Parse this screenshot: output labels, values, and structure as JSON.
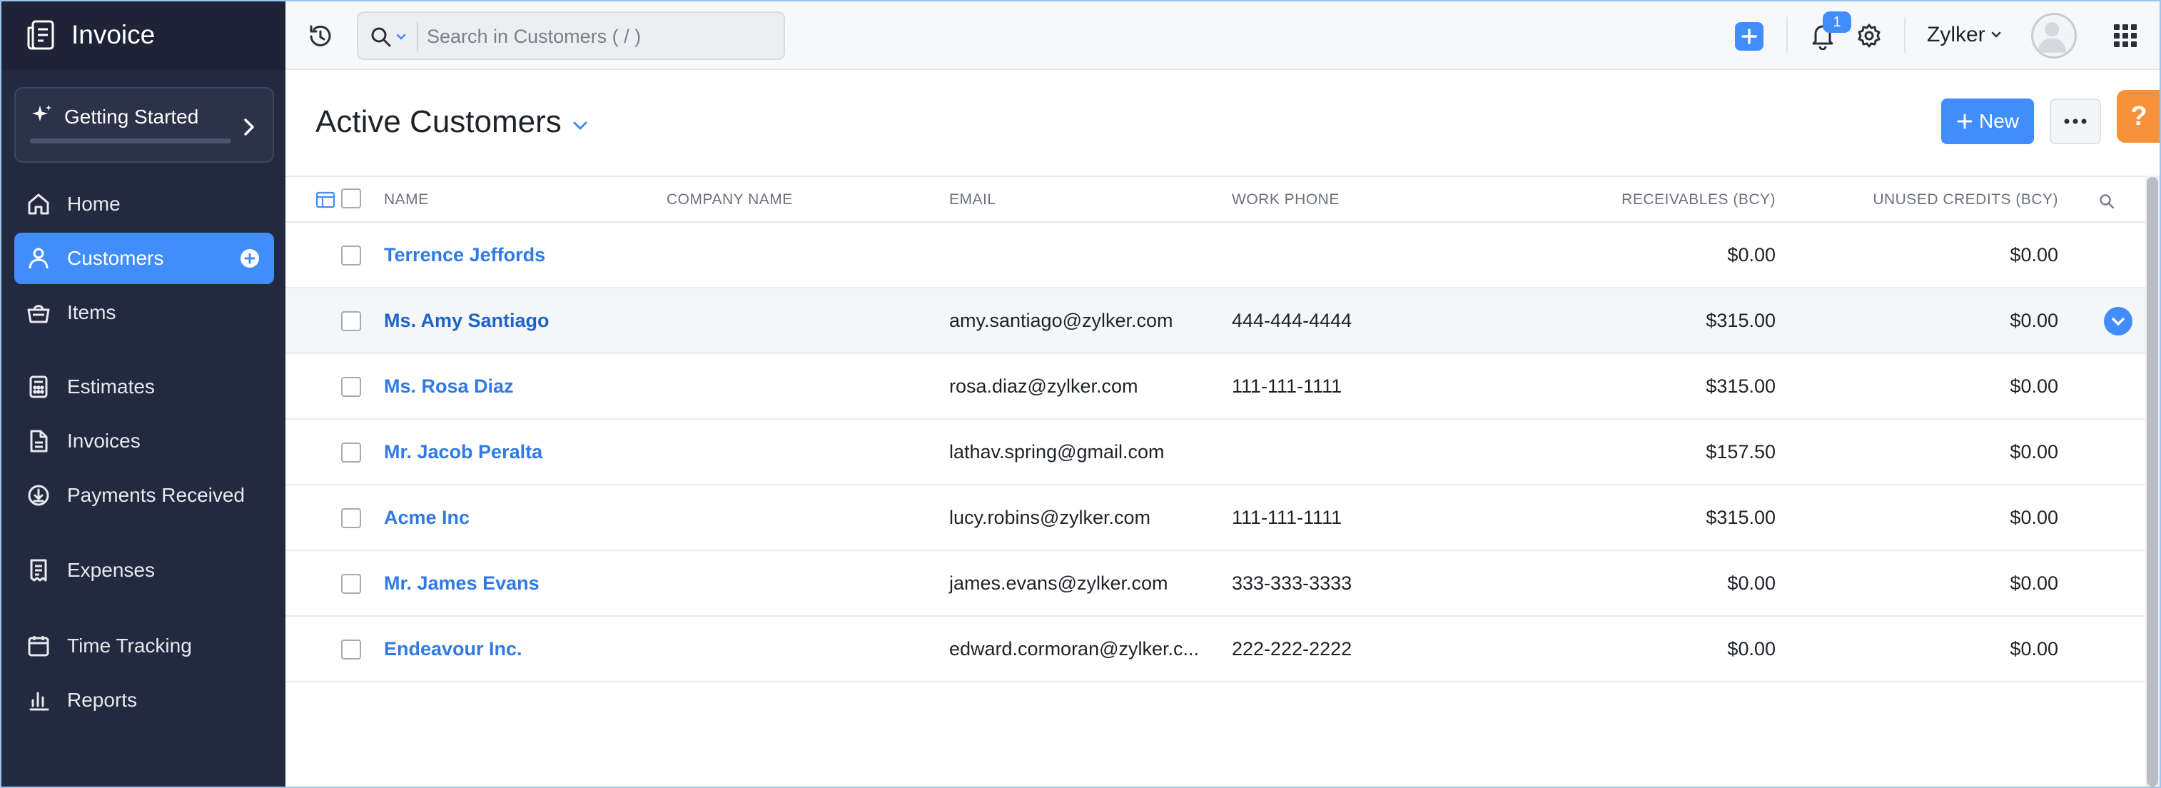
{
  "app": {
    "name": "Invoice"
  },
  "sidebar": {
    "getting_started": "Getting Started",
    "items": [
      {
        "label": "Home",
        "icon": "home-icon"
      },
      {
        "label": "Customers",
        "icon": "user-icon",
        "active": true
      },
      {
        "label": "Items",
        "icon": "basket-icon"
      },
      {
        "label": "Estimates",
        "icon": "calculator-icon"
      },
      {
        "label": "Invoices",
        "icon": "document-icon"
      },
      {
        "label": "Payments Received",
        "icon": "download-circle-icon"
      },
      {
        "label": "Expenses",
        "icon": "receipt-icon"
      },
      {
        "label": "Time Tracking",
        "icon": "calendar-icon"
      },
      {
        "label": "Reports",
        "icon": "bar-chart-icon"
      }
    ]
  },
  "topbar": {
    "search_placeholder": "Search in Customers ( / )",
    "notifications_count": "1",
    "org_name": "Zylker"
  },
  "header": {
    "title": "Active Customers",
    "new_label": "New",
    "help_label": "?"
  },
  "table": {
    "columns": {
      "name": "NAME",
      "company": "COMPANY NAME",
      "email": "EMAIL",
      "phone": "WORK PHONE",
      "receivables": "RECEIVABLES (BCY)",
      "credits": "UNUSED CREDITS (BCY)"
    },
    "rows": [
      {
        "name": "Terrence Jeffords",
        "company": "",
        "email": "",
        "phone": "",
        "receivables": "$0.00",
        "credits": "$0.00"
      },
      {
        "name": "Ms. Amy Santiago",
        "company": "",
        "email": "amy.santiago@zylker.com",
        "phone": "444-444-4444",
        "receivables": "$315.00",
        "credits": "$0.00"
      },
      {
        "name": "Ms. Rosa Diaz",
        "company": "",
        "email": "rosa.diaz@zylker.com",
        "phone": "111-111-1111",
        "receivables": "$315.00",
        "credits": "$0.00"
      },
      {
        "name": "Mr. Jacob Peralta",
        "company": "",
        "email": "lathav.spring@gmail.com",
        "phone": "",
        "receivables": "$157.50",
        "credits": "$0.00"
      },
      {
        "name": "Acme Inc",
        "company": "",
        "email": "lucy.robins@zylker.com",
        "phone": "111-111-1111",
        "receivables": "$315.00",
        "credits": "$0.00"
      },
      {
        "name": "Mr. James Evans",
        "company": "",
        "email": "james.evans@zylker.com",
        "phone": "333-333-3333",
        "receivables": "$0.00",
        "credits": "$0.00"
      },
      {
        "name": "Endeavour Inc.",
        "company": "",
        "email": "edward.cormoran@zylker.c...",
        "phone": "222-222-2222",
        "receivables": "$0.00",
        "credits": "$0.00"
      }
    ]
  },
  "colors": {
    "accent": "#408dfb",
    "sidebar": "#232a3f",
    "link": "#2f7ae5",
    "help": "#f7923a"
  }
}
